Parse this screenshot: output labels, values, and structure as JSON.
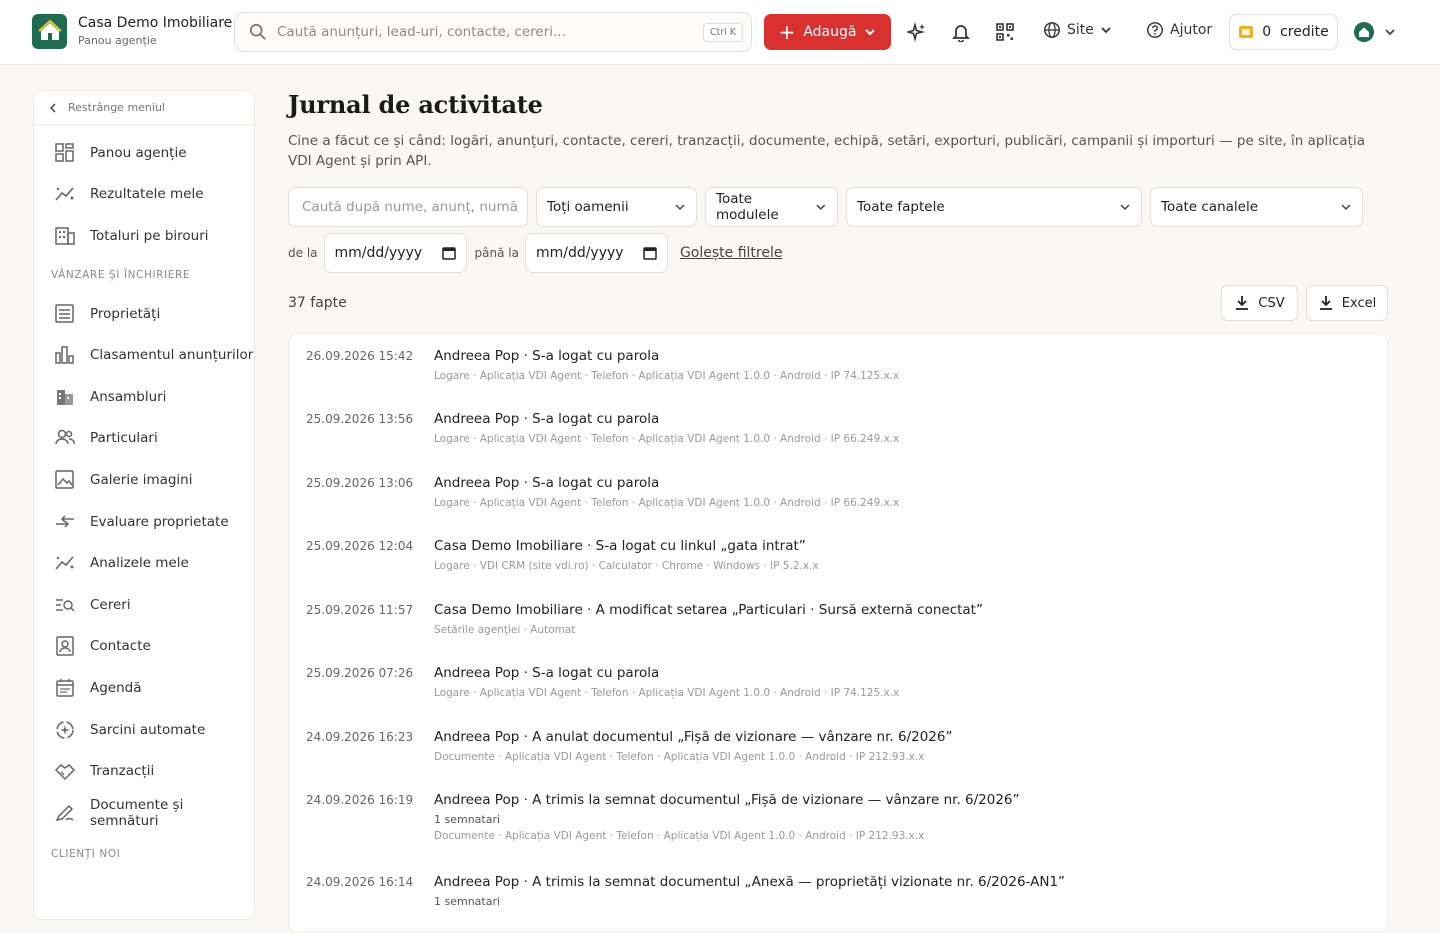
{
  "brand": {
    "name": "Casa Demo Imobiliare",
    "subtitle": "Panou agenție"
  },
  "search": {
    "placeholder": "Caută anunțuri, lead-uri, contacte, cereri...",
    "shortcut": "Ctrl K"
  },
  "header": {
    "add_label": "Adaugă",
    "site_label": "Site",
    "help_label": "Ajutor",
    "credits_label": "0  credite",
    "accent": "#d93030"
  },
  "sidebar": {
    "collapse_label": "Restrânge meniul",
    "items_top": [
      {
        "label": "Panou agenție",
        "icon": "dashboard-icon"
      },
      {
        "label": "Rezultatele mele",
        "icon": "chart-line-icon"
      },
      {
        "label": "Totaluri pe birouri",
        "icon": "building-icon"
      }
    ],
    "section_sales": "VÂNZARE ȘI ÎNCHIRIERE",
    "items_sales": [
      {
        "label": "Proprietăți",
        "icon": "list-icon"
      },
      {
        "label": "Clasamentul anunțurilor",
        "icon": "bar-chart-icon"
      },
      {
        "label": "Ansambluri",
        "icon": "building-icon"
      },
      {
        "label": "Particulari",
        "icon": "people-icon"
      },
      {
        "label": "Galerie imagini",
        "icon": "image-icon"
      },
      {
        "label": "Evaluare proprietate",
        "icon": "arrows-icon"
      },
      {
        "label": "Analizele mele",
        "icon": "chart-line-icon"
      },
      {
        "label": "Cereri",
        "icon": "search-list-icon"
      },
      {
        "label": "Contacte",
        "icon": "contact-icon"
      },
      {
        "label": "Agendă",
        "icon": "calendar-icon"
      },
      {
        "label": "Sarcini automate",
        "icon": "automation-icon"
      },
      {
        "label": "Tranzacții",
        "icon": "handshake-icon"
      },
      {
        "label": "Documente și semnături",
        "icon": "signature-icon"
      }
    ],
    "section_clients": "CLIENȚI NOI"
  },
  "page": {
    "title": "Jurnal de activitate",
    "description": "Cine a făcut ce și când: logări, anunțuri, contacte, cereri, tranzacții, documente, echipă, setări, exporturi, publicări, campanii și importuri — pe site, în aplicația VDI Agent și prin API."
  },
  "filters": {
    "search_placeholder": "Caută după nume, anunț, numă",
    "people": "Toți oamenii",
    "modules": "Toate modulele",
    "facts": "Toate faptele",
    "channels": "Toate canalele",
    "from_label": "de la",
    "to_label": "până la",
    "from_value": "mm/dd/yyyy",
    "to_value": "mm/dd/yyyy",
    "clear_label": "Golește filtrele"
  },
  "toolbar": {
    "count": "37 fapte",
    "csv_label": "CSV",
    "excel_label": "Excel"
  },
  "activity": [
    {
      "time": "26.09.2026 15:42",
      "who": "Andreea Pop",
      "action": " · S-a logat cu parola",
      "extra": "",
      "meta": "Logare · Aplicația VDI Agent · Telefon · Aplicația VDI Agent 1.0.0 · Android · IP 74.125.x.x"
    },
    {
      "time": "25.09.2026 13:56",
      "who": "Andreea Pop",
      "action": " · S-a logat cu parola",
      "extra": "",
      "meta": "Logare · Aplicația VDI Agent · Telefon · Aplicația VDI Agent 1.0.0 · Android · IP 66.249.x.x"
    },
    {
      "time": "25.09.2026 13:06",
      "who": "Andreea Pop",
      "action": " · S-a logat cu parola",
      "extra": "",
      "meta": "Logare · Aplicația VDI Agent · Telefon · Aplicația VDI Agent 1.0.0 · Android · IP 66.249.x.x"
    },
    {
      "time": "25.09.2026 12:04",
      "who": "Casa Demo Imobiliare",
      "action": " · S-a logat cu linkul „gata intrat”",
      "extra": "",
      "meta": "Logare · VDI CRM (site vdi.ro) · Calculator · Chrome · Windows · IP 5.2.x.x"
    },
    {
      "time": "25.09.2026 11:57",
      "who": "Casa Demo Imobiliare",
      "action": " · A modificat setarea „Particulari · Sursă externă conectat”",
      "extra": "",
      "meta": "Setările agenției · Automat"
    },
    {
      "time": "25.09.2026 07:26",
      "who": "Andreea Pop",
      "action": " · S-a logat cu parola",
      "extra": "",
      "meta": "Logare · Aplicația VDI Agent · Telefon · Aplicația VDI Agent 1.0.0 · Android · IP 74.125.x.x"
    },
    {
      "time": "24.09.2026 16:23",
      "who": "Andreea Pop",
      "action": " · A anulat documentul „Fișă de vizionare — vânzare nr. 6/2026”",
      "extra": "",
      "meta": "Documente · Aplicația VDI Agent · Telefon · Aplicația VDI Agent 1.0.0 · Android · IP 212.93.x.x"
    },
    {
      "time": "24.09.2026 16:19",
      "who": "Andreea Pop",
      "action": " · A trimis la semnat documentul „Fișă de vizionare — vânzare nr. 6/2026”",
      "extra": "1 semnatari",
      "meta": "Documente · Aplicația VDI Agent · Telefon · Aplicația VDI Agent 1.0.0 · Android · IP 212.93.x.x"
    },
    {
      "time": "24.09.2026 16:14",
      "who": "Andreea Pop",
      "action": " · A trimis la semnat documentul „Anexă — proprietăți vizionate nr. 6/2026-AN1”",
      "extra": "1 semnatari",
      "meta": ""
    }
  ]
}
